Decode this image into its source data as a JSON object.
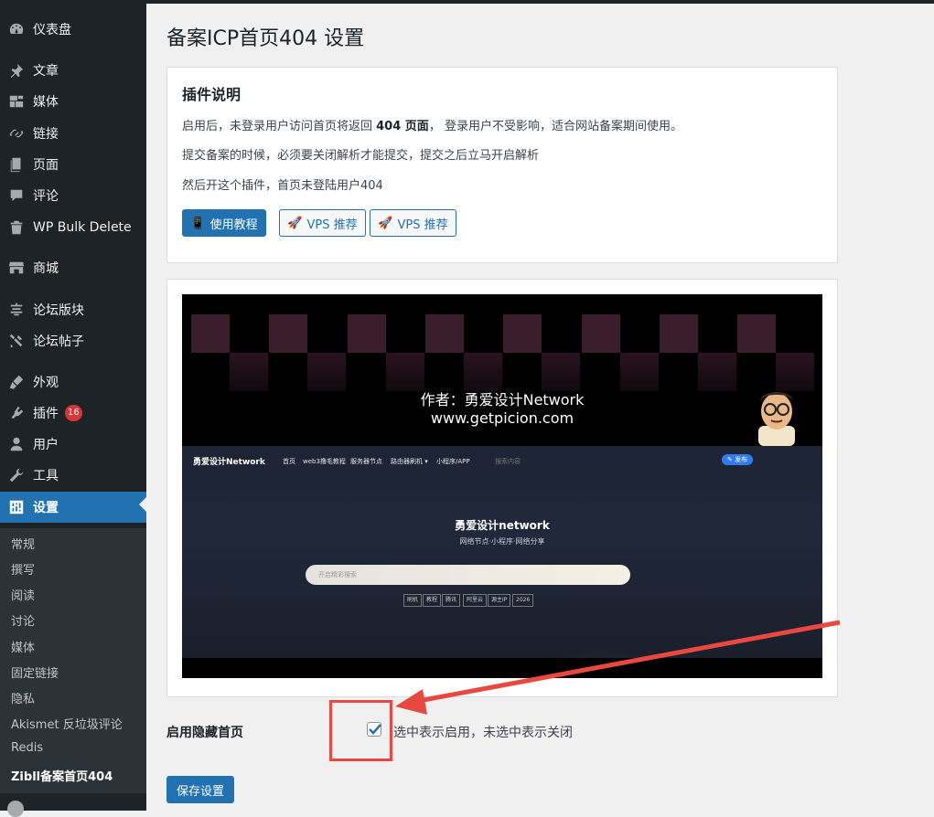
{
  "sidebar": {
    "items": [
      {
        "label": "仪表盘",
        "icon": "dashboard-icon"
      },
      {
        "label": "文章",
        "icon": "pin-icon"
      },
      {
        "label": "媒体",
        "icon": "media-icon"
      },
      {
        "label": "链接",
        "icon": "link-icon"
      },
      {
        "label": "页面",
        "icon": "page-icon"
      },
      {
        "label": "评论",
        "icon": "comment-icon"
      },
      {
        "label": "WP Bulk Delete",
        "icon": "trash-icon"
      },
      {
        "label": "商城",
        "icon": "store-icon"
      },
      {
        "label": "论坛版块",
        "icon": "forum-icon"
      },
      {
        "label": "论坛帖子",
        "icon": "tools-icon"
      },
      {
        "label": "外观",
        "icon": "appearance-icon"
      },
      {
        "label": "插件",
        "icon": "plugin-icon",
        "badge": "16"
      },
      {
        "label": "用户",
        "icon": "user-icon"
      },
      {
        "label": "工具",
        "icon": "wrench-icon"
      },
      {
        "label": "设置",
        "icon": "settings-icon"
      }
    ],
    "submenu": [
      "常规",
      "撰写",
      "阅读",
      "讨论",
      "媒体",
      "固定链接",
      "隐私",
      "Akismet 反垃圾评论",
      "Redis",
      "Zibll备案首页404"
    ]
  },
  "page": {
    "title": "备案ICP首页404 设置",
    "card_heading": "插件说明",
    "para1_prefix": "启用后，未登录用户访问首页将返回 ",
    "para1_bold": "404 页面",
    "para1_suffix": "， 登录用户不受影响，适合网站备案期间使用。",
    "para2": "提交备案的时候，必须要关闭解析才能提交，提交之后立马开启解析",
    "para3": "然后开这个插件，首页未登陆用户404",
    "btn_tutorial": "使用教程",
    "btn_vps1": "VPS 推荐",
    "btn_vps2": "VPS 推荐"
  },
  "screenshot": {
    "author_line1": "作者：勇爱设计Network",
    "author_line2": "www.getpicion.com",
    "logo": "勇爱设计Network",
    "nav": [
      "首页",
      "web3撸毛教程",
      "服务器节点",
      "路由器刷机 ▾",
      "小程序/APP",
      "搜索内容"
    ],
    "publish": "✎ 发布",
    "hero_title": "勇爱设计network",
    "hero_sub": "网络节点·小程序·网络分享",
    "search_placeholder": "开启精彩搜索",
    "tags": [
      "刷机",
      "教程",
      "腾讯",
      "阿里云",
      "源主IP",
      "2026"
    ]
  },
  "settings": {
    "enable_label": "启用隐藏首页",
    "enable_desc": "选中表示启用，未选中表示关闭",
    "enable_checked": true,
    "save_label": "保存设置"
  },
  "colors": {
    "sidebar_bg": "#1d2327",
    "accent": "#2271b1",
    "badge": "#d63638",
    "annotation": "#e8483f"
  }
}
